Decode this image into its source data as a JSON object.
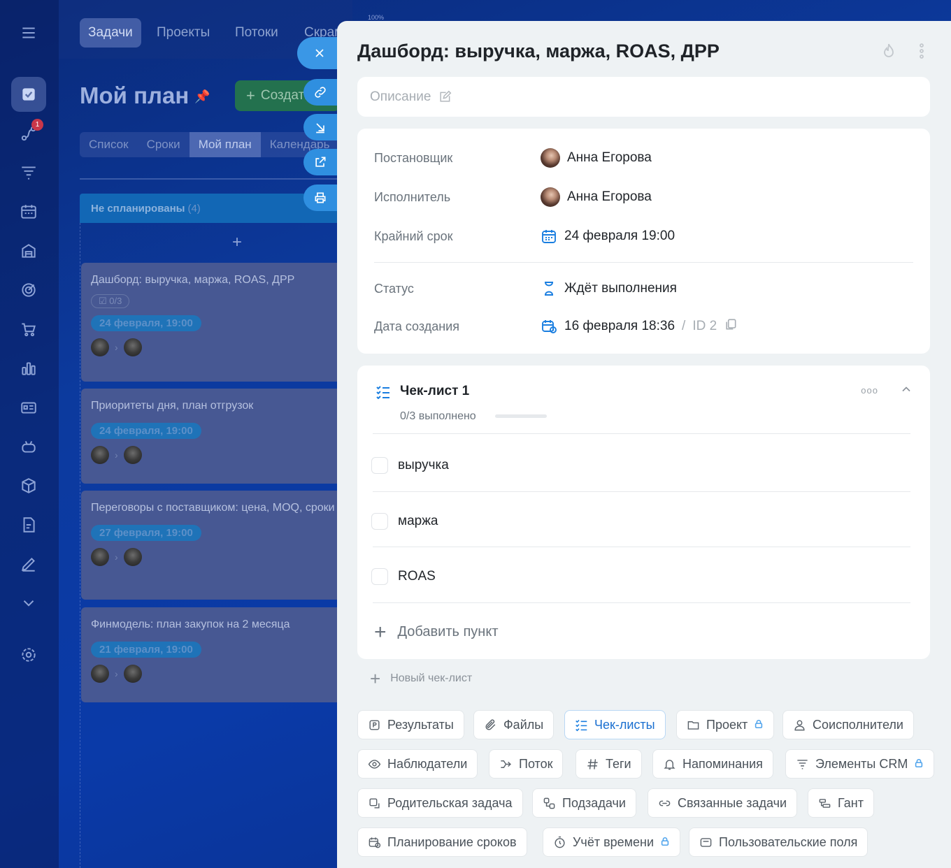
{
  "colors": {
    "accent": "#1a7ee0",
    "panel_bg": "#eef2f4",
    "create_button": "#23714e",
    "column_header": "#1267b5"
  },
  "zoom": "100%",
  "sidebar": {
    "icons": [
      "menu-icon",
      "tasks-icon",
      "flows-icon",
      "funnel-icon",
      "calendar-icon",
      "store-icon",
      "target-icon",
      "cart-icon",
      "chart-icon",
      "cards-icon",
      "bot-icon",
      "box-icon",
      "document-icon",
      "pen-icon",
      "chevron-down-icon",
      "gear-icon"
    ],
    "flows_badge": "1"
  },
  "topnav": {
    "tasks": "Задачи",
    "projects": "Проекты",
    "flows": "Потоки",
    "scrum": "Скрам"
  },
  "page": {
    "title": "Мой план",
    "create_label": "Создать"
  },
  "view_tabs": [
    "Список",
    "Сроки",
    "Мой план",
    "Календарь"
  ],
  "column": {
    "title": "Не спланированы",
    "count": "(4)"
  },
  "kanban_cards": [
    {
      "title": "Дашборд: выручка, маржа, ROAS, ДРР",
      "checklist": "0/3",
      "date": "24 февраля, 19:00"
    },
    {
      "title": "Приоритеты дня, план отгрузок",
      "date": "24 февраля, 19:00"
    },
    {
      "title": "Переговоры с поставщиком: цена, MOQ, сроки",
      "date": "27 февраля, 19:00"
    },
    {
      "title": "Финмодель: план закупок на 2 месяца",
      "date": "21 февраля, 19:00"
    }
  ],
  "task": {
    "title": "Дашборд: выручка, маржа, ROAS, ДРР",
    "description_placeholder": "Описание",
    "fields": {
      "creator_label": "Постановщик",
      "creator": "Анна Егорова",
      "assignee_label": "Исполнитель",
      "assignee": "Анна Егорова",
      "deadline_label": "Крайний срок",
      "deadline": "24 февраля 19:00",
      "status_label": "Статус",
      "status": "Ждёт выполнения",
      "created_label": "Дата создания",
      "created": "16 февраля 18:36",
      "id_sep": "/",
      "id": "ID 2"
    },
    "checklist": {
      "title": "Чек-лист 1",
      "progress": "0/3 выполнено",
      "progress_fraction": 0,
      "items": [
        "выручка",
        "маржа",
        "ROAS"
      ],
      "add_item": "Добавить пункт"
    },
    "new_checklist": "Новый чек-лист",
    "chips": {
      "results": "Результаты",
      "files": "Файлы",
      "checklists": "Чек-листы",
      "project": "Проект",
      "coexecutors": "Соисполнители",
      "observers": "Наблюдатели",
      "flow": "Поток",
      "tags": "Теги",
      "reminders": "Напоминания",
      "crm": "Элементы CRM",
      "parent": "Родительская задача",
      "subtasks": "Подзадачи",
      "related": "Связанные задачи",
      "gantt": "Гант",
      "planning": "Планирование сроков",
      "time": "Учёт времени",
      "custom_fields": "Пользовательские поля"
    }
  }
}
